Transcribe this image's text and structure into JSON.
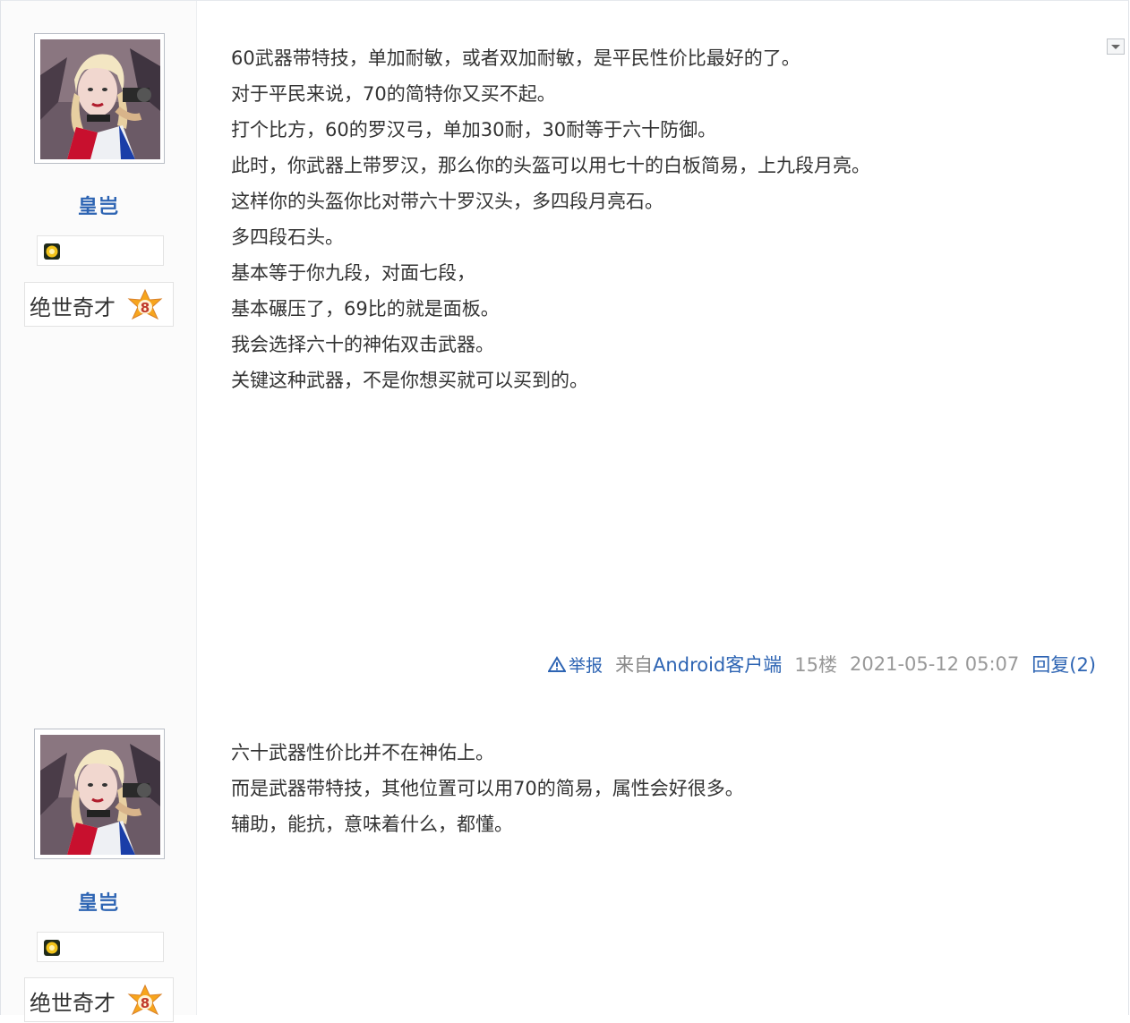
{
  "posts": [
    {
      "user": {
        "name": "皇岂",
        "level_title": "绝世奇才",
        "level_number": "8"
      },
      "lines": [
        "60武器带特技，单加耐敏，或者双加耐敏，是平民性价比最好的了。",
        "对于平民来说，70的简特你又买不起。",
        "打个比方，60的罗汉弓，单加30耐，30耐等于六十防御。",
        "此时，你武器上带罗汉，那么你的头盔可以用七十的白板简易，上九段月亮。",
        "这样你的头盔你比对带六十罗汉头，多四段月亮石。",
        "多四段石头。",
        "基本等于你九段，对面七段，",
        "基本碾压了，69比的就是面板。",
        "我会选择六十的神佑双击武器。",
        "关键这种武器，不是你想买就可以买到的。"
      ],
      "tail": {
        "report": "举报",
        "source_prefix": "来自",
        "source_client": "Android客户端",
        "floor": "15楼",
        "time": "2021-05-12 05:07",
        "reply": "回复(2)"
      }
    },
    {
      "user": {
        "name": "皇岂",
        "level_title": "绝世奇才",
        "level_number": "8"
      },
      "lines": [
        "六十武器性价比并不在神佑上。",
        "而是武器带特技，其他位置可以用70的简易，属性会好很多。",
        "辅助，能抗，意味着什么，都懂。"
      ]
    }
  ],
  "colors": {
    "link": "#2d64b3",
    "text": "#333333",
    "meta": "#999999",
    "level_badge": "#f7a51c"
  },
  "icons": [
    "avatar",
    "honor-badge-icon",
    "level-badge-icon",
    "warning-icon",
    "chevron-down-icon"
  ]
}
